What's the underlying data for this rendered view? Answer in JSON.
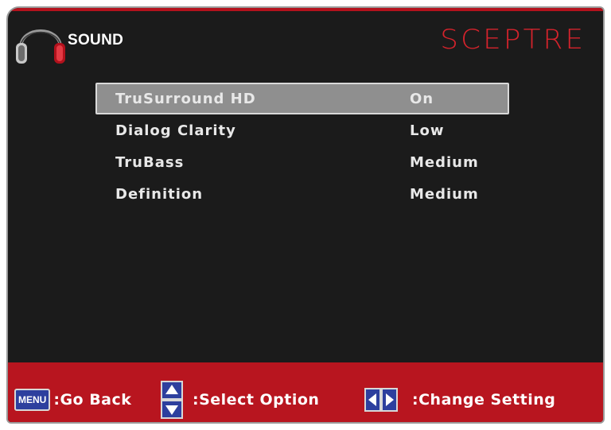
{
  "header": {
    "title": "SOUND",
    "brand": "SCEPTRE"
  },
  "menu": {
    "items": [
      {
        "label": "TruSurround HD",
        "value": "On",
        "selected": true
      },
      {
        "label": "Dialog Clarity",
        "value": "Low",
        "selected": false
      },
      {
        "label": "TruBass",
        "value": "Medium",
        "selected": false
      },
      {
        "label": "Definition",
        "value": "Medium",
        "selected": false
      }
    ]
  },
  "footer": {
    "menu_key": "MENU",
    "go_back": ":Go Back",
    "select_option": ":Select Option",
    "change_setting": ":Change Setting"
  },
  "colors": {
    "background": "#1b1b1b",
    "accent_red": "#b8151f",
    "brand_red": "#d6232c",
    "selection": "#8f8f8f",
    "menu_key_blue": "#2d3f9e"
  },
  "icons": {
    "header": "headphones-icon",
    "up_down": "up-down-arrows-icon",
    "left_right": "left-right-arrows-icon"
  }
}
